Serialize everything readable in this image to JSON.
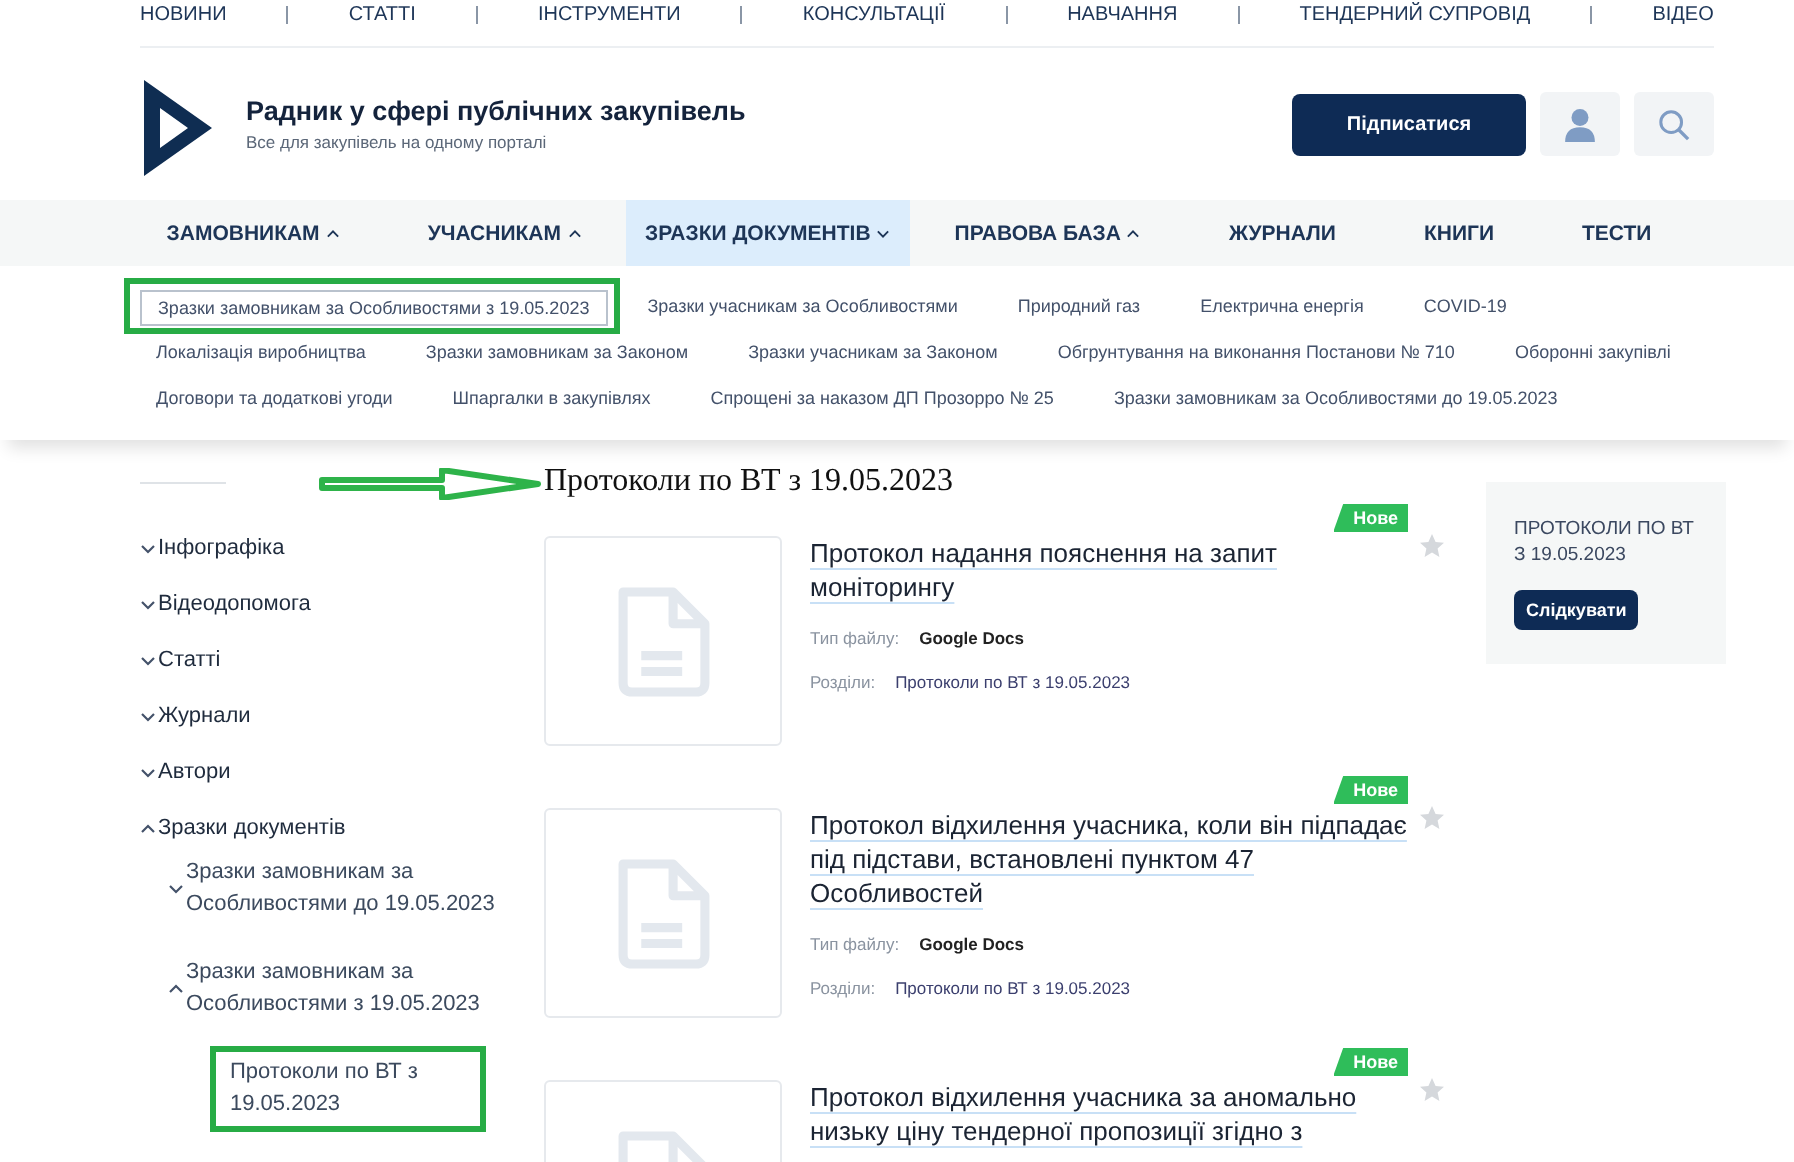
{
  "top_nav": [
    "НОВИНИ",
    "СТАТТІ",
    "ІНСТРУМЕНТИ",
    "КОНСУЛЬТАЦІЇ",
    "НАВЧАННЯ",
    "ТЕНДЕРНИЙ СУПРОВІД",
    "ВІДЕО"
  ],
  "brand": {
    "title": "Радник у сфері публічних закупівель",
    "subtitle": "Все для закупівель на одному порталі"
  },
  "subscribe_button": "Підписатися",
  "main_nav": [
    {
      "label": "ЗАМОВНИКАМ",
      "has_menu": true,
      "selected": false
    },
    {
      "label": "УЧАСНИКАМ",
      "has_menu": true,
      "selected": false
    },
    {
      "label": "ЗРАЗКИ ДОКУМЕНТІВ",
      "has_menu": true,
      "selected": true
    },
    {
      "label": "ПРАВОВА БАЗА",
      "has_menu": true,
      "selected": false
    },
    {
      "label": "ЖУРНАЛИ",
      "has_menu": false,
      "selected": false
    },
    {
      "label": "КНИГИ",
      "has_menu": false,
      "selected": false
    },
    {
      "label": "ТЕСТИ",
      "has_menu": false,
      "selected": false
    }
  ],
  "sub_nav": [
    [
      {
        "label": "Зразки замовникам за Особливостями з 19.05.2023",
        "selected": true,
        "highlighted": true
      },
      {
        "label": "Зразки учасникам за Особливостями",
        "selected": false,
        "highlighted": false
      },
      {
        "label": "Природний газ",
        "selected": false,
        "highlighted": false
      },
      {
        "label": "Електрична енергія",
        "selected": false,
        "highlighted": false
      },
      {
        "label": "COVID-19",
        "selected": false,
        "highlighted": false
      }
    ],
    [
      {
        "label": "Локалізація виробництва",
        "selected": false,
        "highlighted": false
      },
      {
        "label": "Зразки замовникам за Законом",
        "selected": false,
        "highlighted": false
      },
      {
        "label": "Зразки учасникам за Законом",
        "selected": false,
        "highlighted": false
      },
      {
        "label": "Обгрунтування на виконання Постанови № 710",
        "selected": false,
        "highlighted": false
      },
      {
        "label": "Оборонні закупівлі",
        "selected": false,
        "highlighted": false
      }
    ],
    [
      {
        "label": "Договори та додаткові угоди",
        "selected": false,
        "highlighted": false
      },
      {
        "label": "Шпаргалки в закупівлях",
        "selected": false,
        "highlighted": false
      },
      {
        "label": "Спрощені за наказом ДП Прозорро № 25",
        "selected": false,
        "highlighted": false
      },
      {
        "label": "Зразки замовникам за Особливостями до 19.05.2023",
        "selected": false,
        "highlighted": false
      }
    ]
  ],
  "sidebar": [
    {
      "label": "Інфографіка",
      "expanded": false
    },
    {
      "label": "Відеодопомога",
      "expanded": false
    },
    {
      "label": "Статті",
      "expanded": false
    },
    {
      "label": "Журнали",
      "expanded": false
    },
    {
      "label": "Автори",
      "expanded": false
    },
    {
      "label": "Зразки документів",
      "expanded": true,
      "children": [
        {
          "label": "Зразки замовникам за Особливостями до 19.05.2023",
          "expanded": false
        },
        {
          "label": "Зразки замовникам за Особливостями з 19.05.2023",
          "expanded": true,
          "children": [
            {
              "label": "Протоколи по ВТ з 19.05.2023",
              "highlighted": true
            }
          ]
        }
      ]
    }
  ],
  "page_title": {
    "text": "Протоколи по ВТ з 19.05.2023",
    "arrow": true
  },
  "documents": [
    {
      "title": "Протокол надання пояснення на запит моніторингу",
      "badge": "Нове",
      "file_type_label": "Тип файлу:",
      "file_type": "Google Docs",
      "sections_label": "Розділи:",
      "section": "Протоколи по ВТ з 19.05.2023"
    },
    {
      "title": "Протокол відхилення учасника, коли він підпадає під підстави, встановлені пунктом 47 Особливостей",
      "badge": "Нове",
      "file_type_label": "Тип файлу:",
      "file_type": "Google Docs",
      "sections_label": "Розділи:",
      "section": "Протоколи по ВТ з 19.05.2023"
    },
    {
      "title": "Протокол відхилення учасника за аномально низьку ціну тендерної пропозиції згідно з",
      "badge": "Нове"
    }
  ],
  "follow_box": {
    "title": "ПРОТОКОЛИ ПО ВТ З 19.05.2023",
    "button": "Слідкувати"
  }
}
